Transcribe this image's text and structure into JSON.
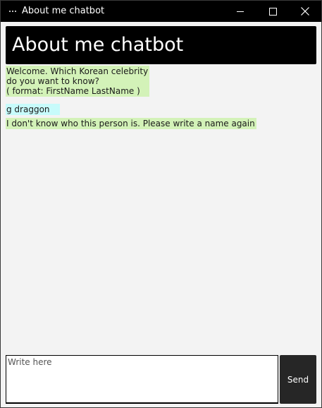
{
  "window": {
    "title": "About me chatbot",
    "app_icon": "app-icon",
    "controls": {
      "minimize_icon": "minimize-icon",
      "maximize_icon": "maximize-icon",
      "close_icon": "close-icon"
    }
  },
  "header": {
    "title": "About me chatbot"
  },
  "chat": {
    "messages": [
      {
        "sender": "bot",
        "text": "Welcome. Which Korean celebrity\ndo you want to know?\n( format: FirstName LastName )"
      },
      {
        "sender": "user",
        "text": "g draggon"
      },
      {
        "sender": "bot",
        "text": "I don't know who this person is. Please write a name again"
      }
    ]
  },
  "input": {
    "placeholder": "Write here",
    "value": ""
  },
  "send_button": {
    "label": "Send"
  },
  "colors": {
    "titlebar": "#000000",
    "header_bg": "#000000",
    "bot_bubble": "#d3f2b8",
    "user_bubble": "#c7fbfb",
    "chat_bg": "#f3f3f3",
    "send_bg": "#262626"
  }
}
